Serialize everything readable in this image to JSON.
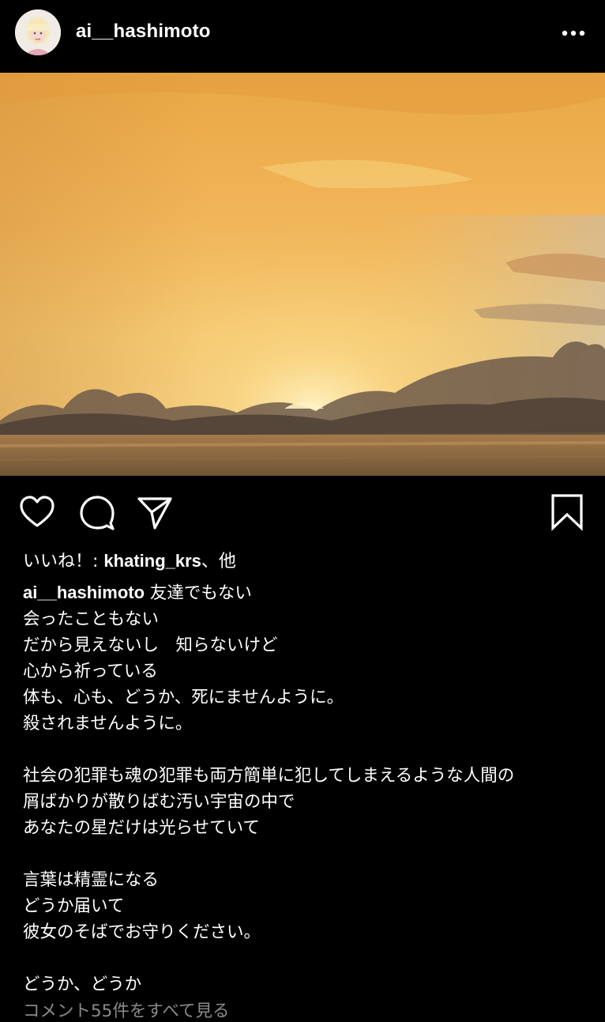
{
  "post": {
    "username": "ai__hashimoto",
    "likes_prefix": "いいね！: ",
    "likes_user": "khating_krs",
    "likes_suffix": "、他",
    "caption_first": "友達でもない",
    "caption_lines": [
      "会ったこともない",
      "だから見えないし　知らないけど",
      "心から祈っている",
      "体も、心も、どうか、死にませんように。",
      "殺されませんように。",
      "",
      "社会の犯罪も魂の犯罪も両方簡単に犯してしまえるような人間の",
      "屑ばかりが散りばむ汚い宇宙の中で",
      "あなたの星だけは光らせていて",
      "",
      "言葉は精霊になる",
      "どうか届いて",
      "彼女のそばでお守りください。",
      "",
      "どうか、どうか"
    ],
    "view_comments": "コメント55件をすべて見る"
  },
  "icons": {
    "more": "more-options-icon",
    "like": "heart-icon",
    "comment": "comment-bubble-icon",
    "share": "paper-plane-icon",
    "save": "bookmark-icon"
  },
  "colors": {
    "background": "#000000",
    "text": "#ffffff",
    "muted": "#8a8a8a"
  }
}
